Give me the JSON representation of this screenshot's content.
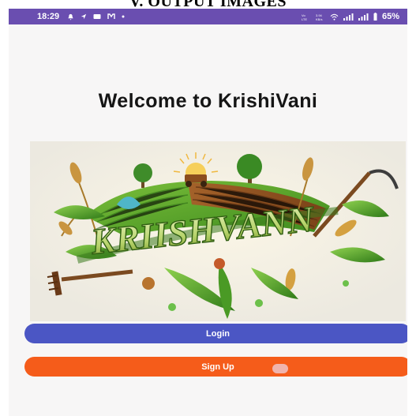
{
  "document": {
    "caption": "V. OUTPUT IMAGES"
  },
  "status_bar": {
    "time": "18:29",
    "battery": "65%",
    "icons_left": [
      "notification-bell-icon",
      "location-arrow-icon",
      "message-icon",
      "m-app-icon",
      "dot-icon"
    ],
    "icons_right": [
      "volte-icon",
      "data-speed-icon",
      "wifi-icon",
      "signal-icon",
      "signal-icon",
      "battery-icon"
    ]
  },
  "screen": {
    "title": "Welcome to KrishiVani",
    "logo_text": "KRIISHVANN",
    "login_label": "Login",
    "signup_label": "Sign Up"
  },
  "colors": {
    "status_bar": "#6a4eb0",
    "login_button": "#4b56c4",
    "signup_button": "#f55c1a",
    "background": "#f7f6f6"
  }
}
